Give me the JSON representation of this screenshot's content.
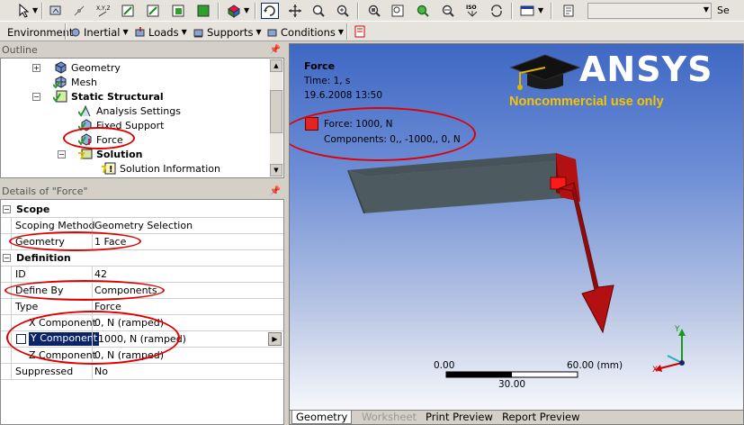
{
  "toolbar_top": {
    "buttons": [
      "select-arrow",
      "graphics-select",
      "node-select",
      "edge-select",
      "vertex-select",
      "body-select",
      "face-select",
      "extend-select",
      "rotate",
      "pan",
      "zoom",
      "box-zoom",
      "zoom-fit",
      "magnifier",
      "iso",
      "refresh",
      "view-options"
    ],
    "search_value": "",
    "select_label": "Se"
  },
  "toolbar_context": {
    "items": [
      {
        "label": "Environment",
        "has_menu": false
      },
      {
        "label": "Inertial",
        "has_menu": true
      },
      {
        "label": "Loads",
        "has_menu": true
      },
      {
        "label": "Supports",
        "has_menu": true
      },
      {
        "label": "Conditions",
        "has_menu": true
      }
    ]
  },
  "outline": {
    "title": "Outline",
    "items": [
      {
        "label": "Geometry",
        "level": 1
      },
      {
        "label": "Mesh",
        "level": 1
      },
      {
        "label": "Static Structural",
        "level": 1,
        "bold": true
      },
      {
        "label": "Analysis Settings",
        "level": 2
      },
      {
        "label": "Fixed Support",
        "level": 2
      },
      {
        "label": "Force",
        "level": 2,
        "selected": true
      },
      {
        "label": "Solution",
        "level": 2,
        "bold": true
      },
      {
        "label": "Solution Information",
        "level": 3
      }
    ]
  },
  "details": {
    "title": "Details of \"Force\"",
    "groups": [
      {
        "name": "Scope",
        "rows": [
          {
            "key": "Scoping Method",
            "value": "Geometry Selection"
          },
          {
            "key": "Geometry",
            "value": "1 Face"
          }
        ]
      },
      {
        "name": "Definition",
        "rows": [
          {
            "key": "ID",
            "value": "42"
          },
          {
            "key": "Define By",
            "value": "Components"
          },
          {
            "key": "Type",
            "value": "Force"
          },
          {
            "key": "X Component",
            "value": "0, N (ramped)"
          },
          {
            "key": "Y Component",
            "value": "-1000, N (ramped)"
          },
          {
            "key": "Z Component",
            "value": "0, N (ramped)"
          },
          {
            "key": "Suppressed",
            "value": "No"
          }
        ]
      }
    ]
  },
  "viewport": {
    "title": "Force",
    "time": "Time: 1, s",
    "date": "19.6.2008 13:50",
    "legend_label": "Force: 1000, N",
    "legend_components": "Components: 0,, -1000,, 0, N",
    "legend_color": "#e52421",
    "brand": "ANSYS",
    "noncommercial": "Noncommercial use only",
    "scale": {
      "left": "0.00",
      "right": "60.00 (mm)",
      "mid": "30.00"
    },
    "axis": {
      "y": "Y",
      "x": "X"
    },
    "tabs": [
      {
        "label": "Geometry",
        "active": true
      },
      {
        "label": "Worksheet",
        "disabled": true
      },
      {
        "label": "Print Preview"
      },
      {
        "label": "Report Preview"
      }
    ]
  },
  "colors": {
    "highlight_circle": "#e00000",
    "selection": "#0a246a",
    "force_arrow": "#b31111"
  }
}
